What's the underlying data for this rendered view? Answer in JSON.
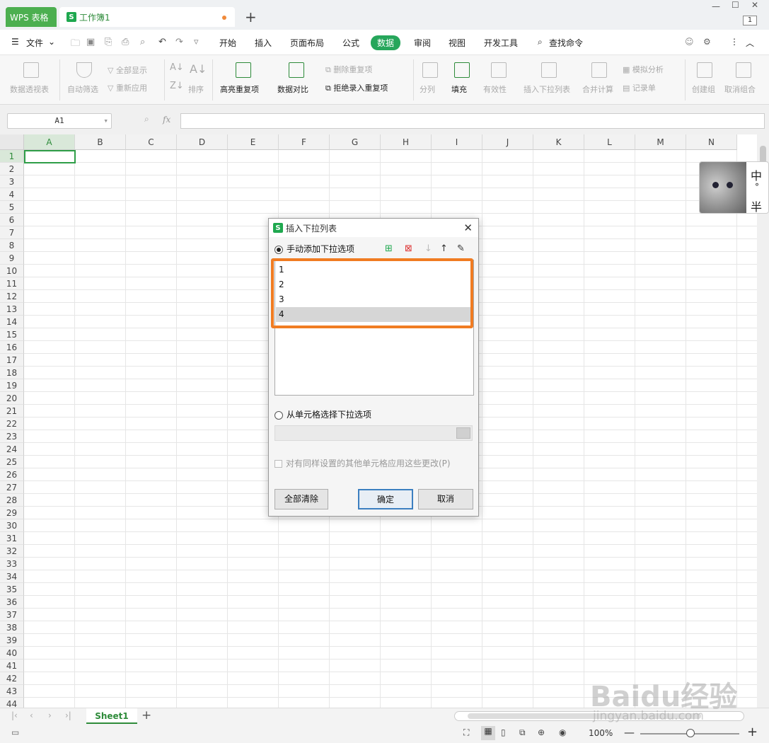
{
  "titlebar": {
    "app_tab": "WPS 表格",
    "doc_tab": "工作簿1",
    "new_tab_icon": "plus-icon",
    "window_counter": "1"
  },
  "menubar": {
    "file": "文件",
    "items": [
      "开始",
      "插入",
      "页面布局",
      "公式",
      "数据",
      "审阅",
      "视图",
      "开发工具"
    ],
    "active": "数据",
    "search": "查找命令"
  },
  "ribbon": {
    "pivot": "数据透视表",
    "autofilter": "自动筛选",
    "show_all": "全部显示",
    "reapply": "重新应用",
    "sort": "排序",
    "highlight_dup": "高亮重复项",
    "compare": "数据对比",
    "remove_dup": "删除重复项",
    "reject_dup": "拒绝录入重复项",
    "split": "分列",
    "fill": "填充",
    "validity": "有效性",
    "insert_dropdown": "插入下拉列表",
    "merge_calc": "合并计算",
    "simulate": "模拟分析",
    "record": "记录单",
    "group": "创建组",
    "ungroup": "取消组合"
  },
  "formulabar": {
    "namebox": "A1",
    "fx": "fx",
    "value": ""
  },
  "grid": {
    "columns": [
      "A",
      "B",
      "C",
      "D",
      "E",
      "F",
      "G",
      "H",
      "I",
      "J",
      "K",
      "L",
      "M",
      "N"
    ],
    "rows": [
      "1",
      "2",
      "3",
      "4",
      "5",
      "6",
      "7",
      "8",
      "9",
      "10",
      "11",
      "12",
      "13",
      "14",
      "15",
      "16",
      "17",
      "18",
      "19",
      "20",
      "21",
      "22",
      "23",
      "24",
      "25",
      "26",
      "27",
      "28",
      "29",
      "30",
      "31",
      "32",
      "33",
      "34",
      "35",
      "36",
      "37",
      "38",
      "39",
      "40",
      "41",
      "42",
      "43",
      "44"
    ]
  },
  "pet": {
    "ime_chars": [
      "中",
      "°",
      "半"
    ]
  },
  "dialog": {
    "title": "插入下拉列表",
    "manual_option": "手动添加下拉选项",
    "items": [
      "1",
      "2",
      "3",
      "4"
    ],
    "selected_item": "4",
    "cell_option": "从单元格选择下拉选项",
    "apply_same": "对有同样设置的其他单元格应用这些更改(P)",
    "clear_all": "全部清除",
    "ok": "确定",
    "cancel": "取消"
  },
  "sheetbar": {
    "sheet": "Sheet1",
    "add_icon": "plus-icon"
  },
  "statusbar": {
    "zoom": "100%"
  },
  "watermark": {
    "brand": "Baidu经验",
    "url": "jingyan.baidu.com"
  },
  "colors": {
    "accent": "#26a65b",
    "highlight_border": "#f07c22",
    "ok_border": "#3c7fc0"
  }
}
